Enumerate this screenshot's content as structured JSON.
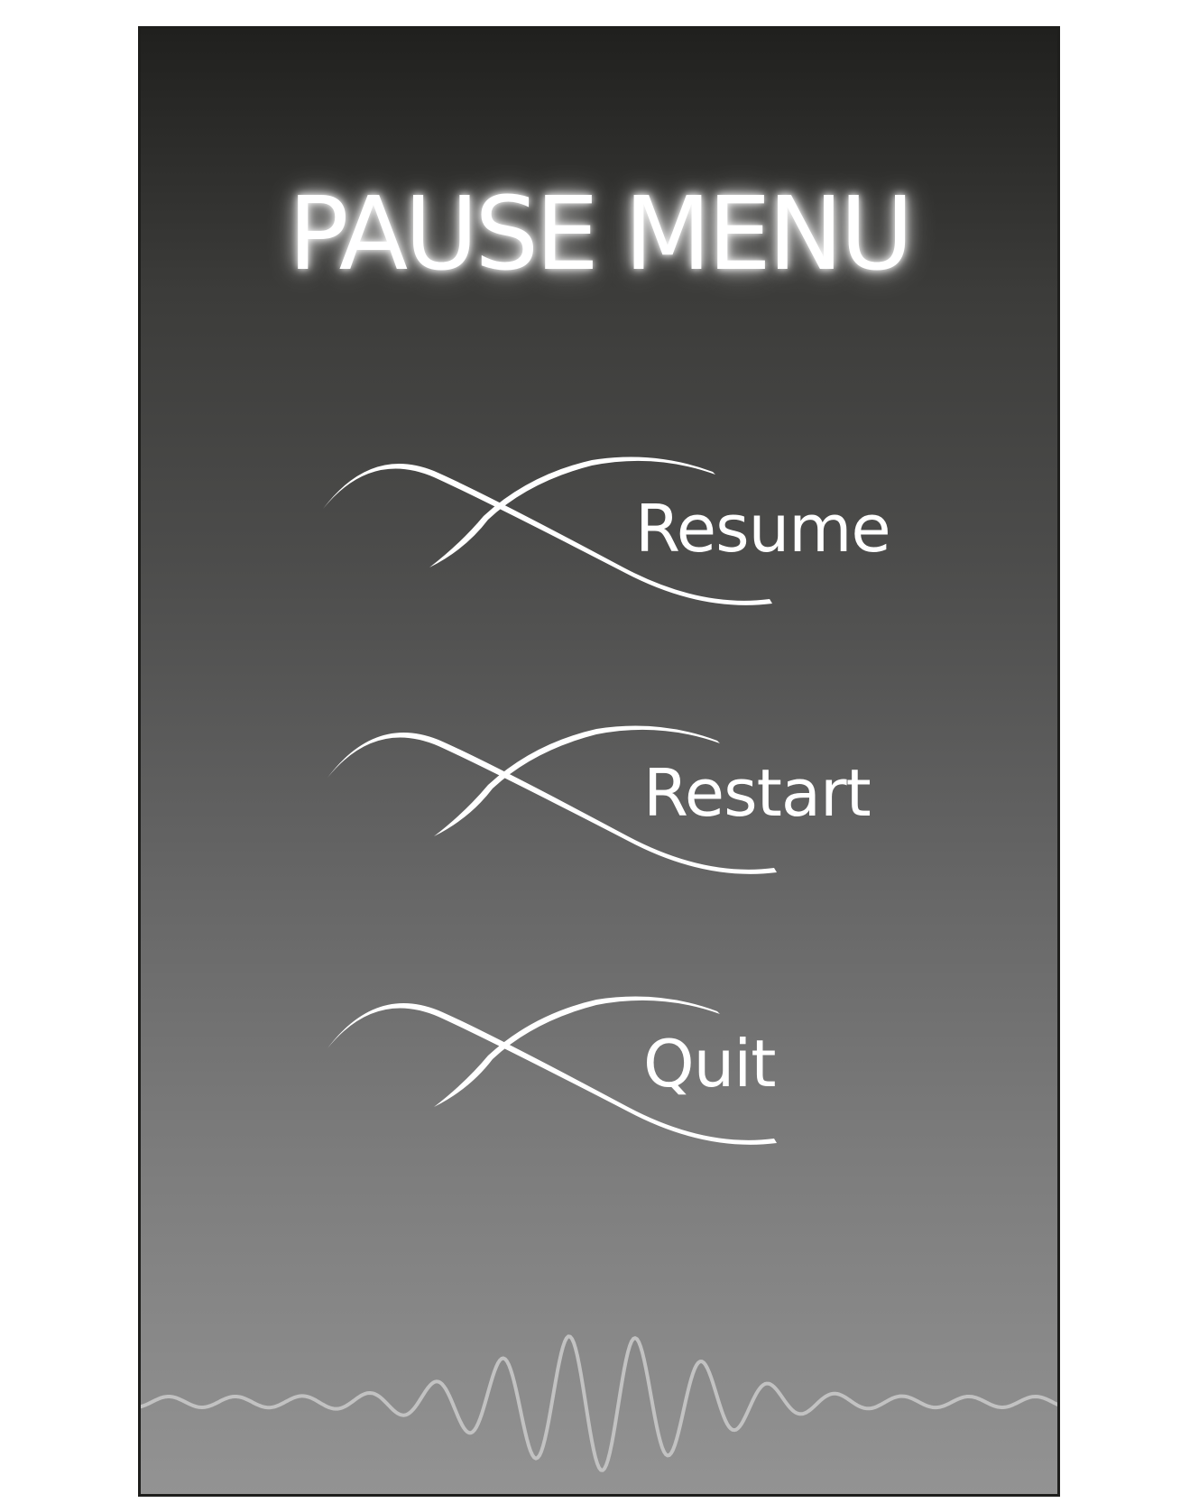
{
  "menu": {
    "title": "PAUSE MENU",
    "items": [
      {
        "label": "Resume"
      },
      {
        "label": "Restart"
      },
      {
        "label": "Quit"
      }
    ]
  },
  "colors": {
    "text": "#ffffff",
    "wave": "#c2c2c2",
    "border": "#1e1e1c"
  },
  "icons": {
    "menu_item_decoration": "crossed-swoosh-icon",
    "footer_decoration": "sound-wave-icon"
  }
}
